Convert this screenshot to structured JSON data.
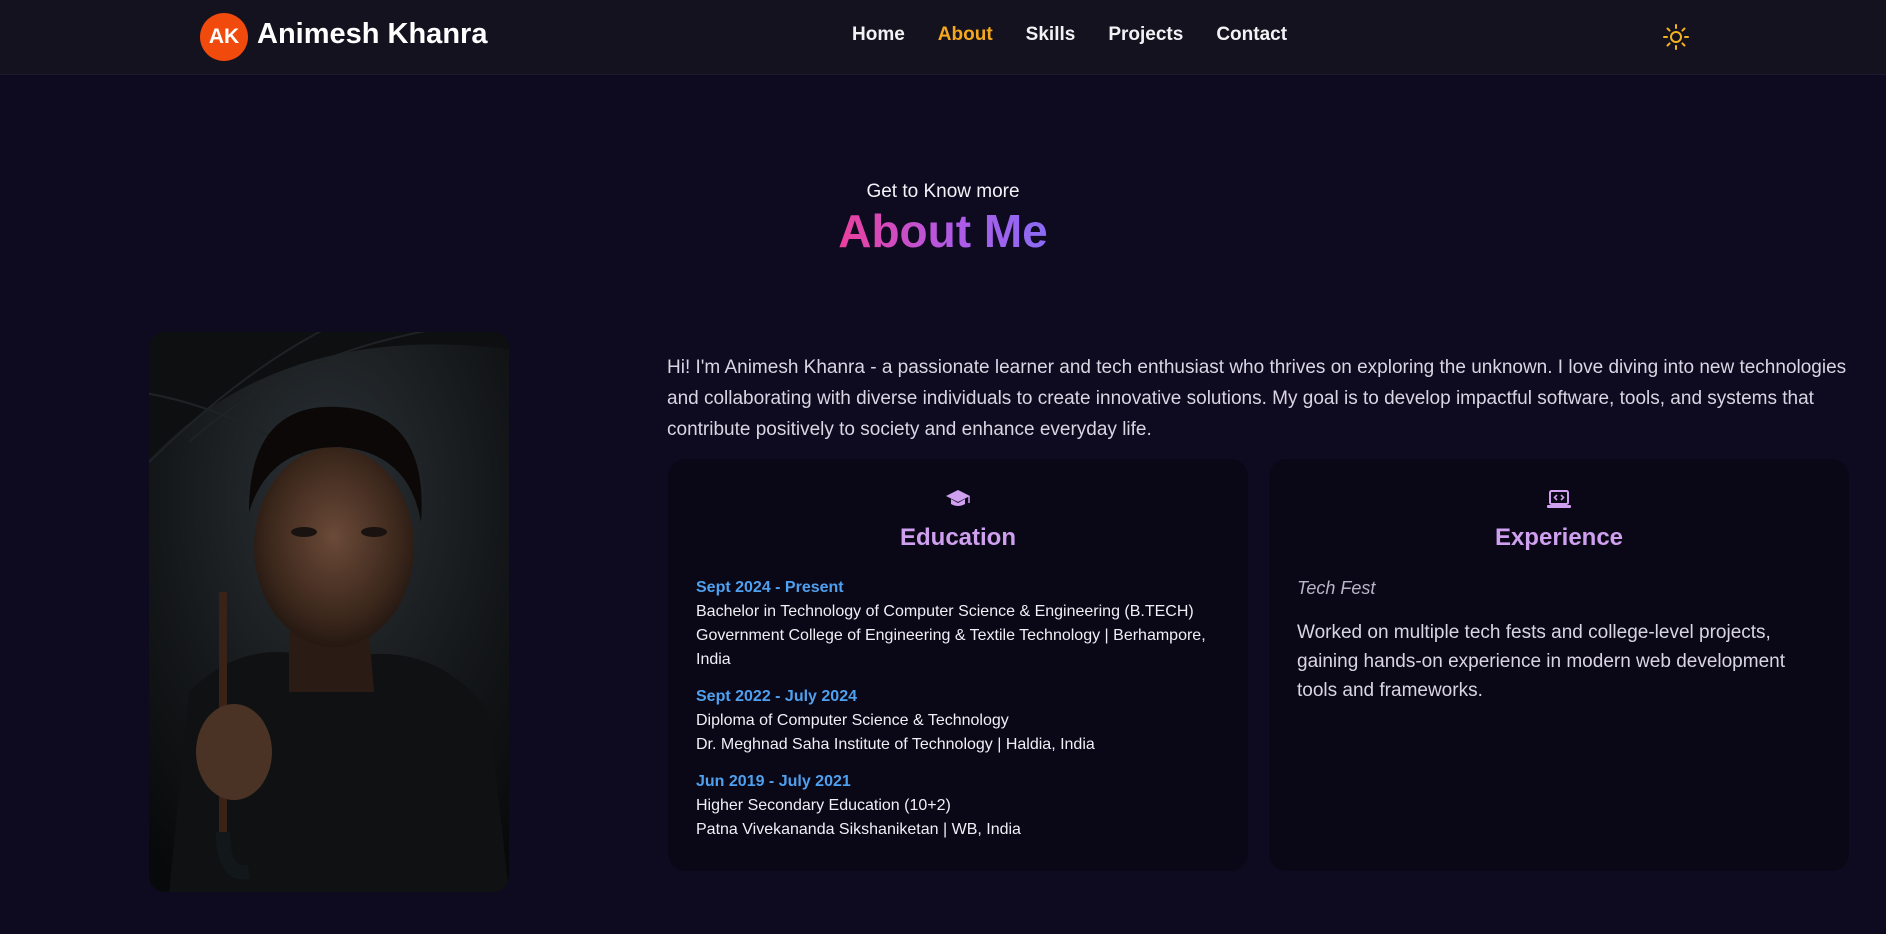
{
  "header": {
    "logo_initials": "AK",
    "brand_name": "Animesh Khanra",
    "nav": [
      {
        "label": "Home"
      },
      {
        "label": "About",
        "active": true
      },
      {
        "label": "Skills"
      },
      {
        "label": "Projects"
      },
      {
        "label": "Contact"
      }
    ],
    "theme_icon": "sun-icon"
  },
  "section": {
    "subtitle": "Get to Know more",
    "title": "About Me"
  },
  "profile_photo": "portrait-photo",
  "intro": "Hi! I'm Animesh Khanra - a passionate learner and tech enthusiast who thrives on exploring the unknown. I love diving into new technologies and collaborating with diverse individuals to create innovative solutions. My goal is to develop impactful software, tools, and systems that contribute positively to society and enhance everyday life.",
  "education": {
    "icon": "graduation-cap-icon",
    "title": "Education",
    "items": [
      {
        "date": "Sept 2024 - Present",
        "degree": "Bachelor in Technology of Computer Science & Engineering (B.TECH)",
        "institution": "Government College of Engineering & Textile Technology | Berhampore, India"
      },
      {
        "date": "Sept 2022 - July 2024",
        "degree": "Diploma of Computer Science & Technology",
        "institution": "Dr. Meghnad Saha Institute of Technology | Haldia, India"
      },
      {
        "date": "Jun 2019 - July 2021",
        "degree": "Higher Secondary Education (10+2)",
        "institution": "Patna Vivekananda Sikshaniketan | WB, India"
      }
    ]
  },
  "experience": {
    "icon": "laptop-code-icon",
    "title": "Experience",
    "organization": "Tech Fest",
    "description": "Worked on multiple tech fests and college-level projects, gaining hands-on experience in modern web development tools and frameworks."
  },
  "colors": {
    "accent": "#f4a71c",
    "logo": "#f04a0d",
    "card_title": "#cf9ff0",
    "date": "#4fa0ee",
    "background": "#0e0a1f"
  }
}
